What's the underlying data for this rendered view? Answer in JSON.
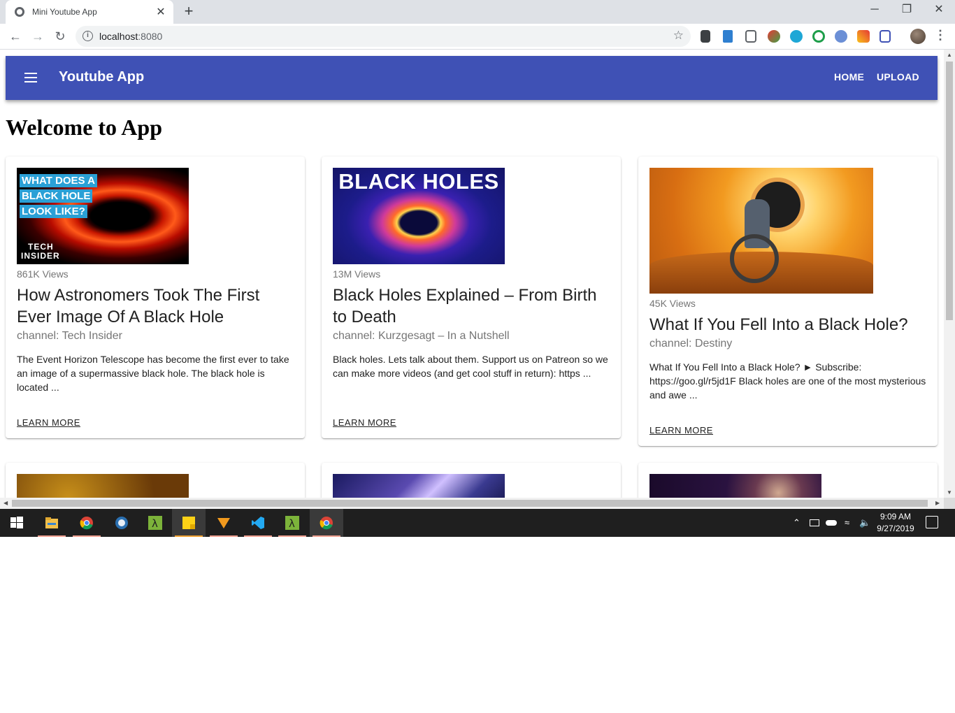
{
  "browser": {
    "tab_title": "Mini Youtube App",
    "tab_close": "✕",
    "new_tab": "+",
    "url_host": "localhost",
    "url_port": ":8080",
    "window_buttons": [
      "─",
      "❐",
      "✕"
    ]
  },
  "app": {
    "title": "Youtube App",
    "nav": [
      "HOME",
      "UPLOAD"
    ],
    "accent_color": "#3f51b5"
  },
  "page": {
    "heading": "Welcome to App"
  },
  "thumb_text": {
    "card1_lines": [
      "WHAT DOES A",
      "BLACK HOLE",
      "LOOK LIKE?"
    ],
    "card1_brand": [
      "TECH",
      "INSIDER"
    ],
    "card2_title": "BLACK HOLES"
  },
  "cards": [
    {
      "views": "861K Views",
      "title": "How Astronomers Took The First Ever Image Of A Black Hole",
      "channel": "channel: Tech Insider",
      "description": "The Event Horizon Telescope has become the first ever to take an image of a supermassive black hole. The black hole is located ...",
      "cta": "LEARN MORE"
    },
    {
      "views": "13M Views",
      "title": "Black Holes Explained – From Birth to Death",
      "channel": "channel: Kurzgesagt – In a Nutshell",
      "description": "Black holes. Lets talk about them. Support us on Patreon so we can make more videos (and get cool stuff in return): https ...",
      "cta": "LEARN MORE"
    },
    {
      "views": "45K Views",
      "title": "What If You Fell Into a Black Hole?",
      "channel": "channel: Destiny",
      "description": "What If You Fell Into a Black Hole? ► Subscribe: https://goo.gl/r5jd1F Black holes are one of the most mysterious and awe ...",
      "cta": "LEARN MORE"
    }
  ],
  "taskbar": {
    "time": "9:09 AM",
    "date": "9/27/2019"
  }
}
